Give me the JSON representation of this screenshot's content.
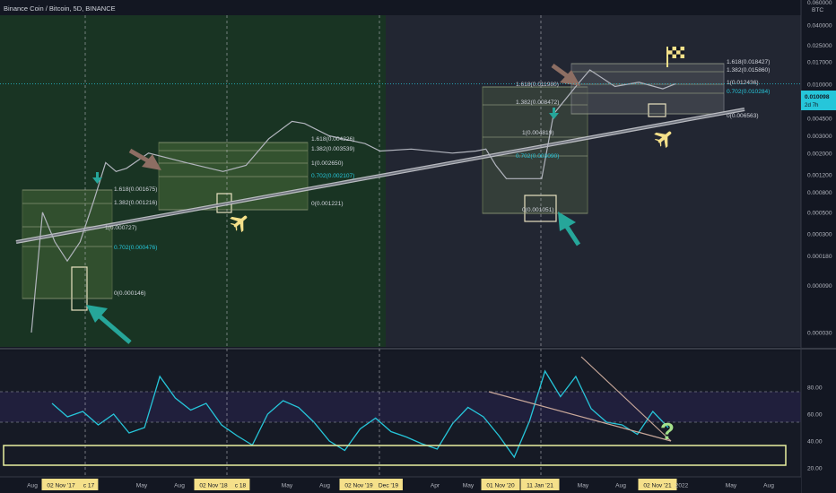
{
  "header": {
    "title": "Binance Coin / Bitcoin, 5D, BINANCE"
  },
  "price_axis": {
    "unit": "BTC",
    "top_tick": "0.060000",
    "ticks": [
      "0.040000",
      "0.025000",
      "0.017000",
      "0.010000",
      "0.007000",
      "0.004500",
      "0.003000",
      "0.002000",
      "0.001200",
      "0.000800",
      "0.000500",
      "0.000300",
      "0.000180",
      "0.000090",
      "0.000030"
    ],
    "current_price": "0.010098",
    "current_label_2": "2d 7h",
    "scale": "log"
  },
  "rsi_axis": {
    "ticks": [
      "80.00",
      "60.00",
      "40.00",
      "20.00"
    ],
    "upper_band": 70,
    "lower_band": 30
  },
  "time_axis": {
    "labels": [
      "Aug",
      "02 Nov '17",
      "c 17",
      "May",
      "Aug",
      "02 Nov '18",
      "c 18",
      "May",
      "Aug",
      "02 Nov '19",
      "Dec '19",
      "Apr",
      "May",
      "01 Nov '20",
      "11 Jan '21",
      "May",
      "Aug",
      "02 Nov '21",
      "2022",
      "May",
      "Aug"
    ],
    "highlighted": [
      "02 Nov '17",
      "c 17",
      "02 Nov '18",
      "c 18",
      "02 Nov '19",
      "Dec '19",
      "01 Nov '20",
      "11 Jan '21",
      "02 Nov '21"
    ]
  },
  "fib_1": {
    "levels": [
      "1.618(0.001675)",
      "1.382(0.001216)",
      "1(0.000727)",
      "0.702(0.000476)",
      "0(0.000146)"
    ]
  },
  "fib_2": {
    "levels": [
      "1.618(0.004226)",
      "1.382(0.003539)",
      "1(0.002650)",
      "0.702(0.002107)",
      "0(0.001221)"
    ]
  },
  "fib_3": {
    "levels": [
      "1.618(0.011980)",
      "1.382(0.008472)",
      "1(0.004819)",
      "0.702(0.003090)",
      "0(0.001051)"
    ]
  },
  "fib_4": {
    "levels": [
      "1.618(0.018427)",
      "1.382(0.015860)",
      "1(0.012436)",
      "0.702(0.010284)",
      "0(0.006563)"
    ]
  },
  "annotations": {
    "question_mark": "?"
  },
  "colors": {
    "background": "#131722",
    "price_line": "#b2b5be",
    "rsi_line": "#26c6da",
    "fib_text": "#d1d4dc",
    "fib_accent": "#26c6da",
    "green_zone": "#1b3a23",
    "arrow_teal": "#26a69a",
    "arrow_brown": "#8d6e63",
    "airplane": "#f5e08a",
    "label_bg": "#f5e08a"
  },
  "chart_data": {
    "type": "line",
    "title": "Binance Coin / Bitcoin, 5D, BINANCE",
    "y_scale": "log",
    "ylim": [
      3e-05,
      0.06
    ],
    "series": [
      {
        "name": "Binance Coin / Bitcoin",
        "x": [
          "2017-07",
          "2017-08",
          "2017-09",
          "2017-10",
          "2017-11",
          "2017-12",
          "2018-01",
          "2018-02",
          "2018-03",
          "2018-05",
          "2018-08",
          "2018-11",
          "2019-01",
          "2019-03",
          "2019-05",
          "2019-06",
          "2019-08",
          "2019-11",
          "2019-12",
          "2020-02",
          "2020-04",
          "2020-06",
          "2020-08",
          "2020-10",
          "2020-11",
          "2021-01",
          "2021-02",
          "2021-04",
          "2021-05",
          "2021-07",
          "2021-09",
          "2021-11",
          "2021-12"
        ],
        "values": [
          3e-05,
          0.0005,
          0.00025,
          0.00016,
          0.00025,
          0.00065,
          0.0016,
          0.0013,
          0.0014,
          0.002,
          0.0016,
          0.0013,
          0.0015,
          0.0028,
          0.0042,
          0.004,
          0.003,
          0.0025,
          0.0021,
          0.0022,
          0.002,
          0.0021,
          0.0022,
          0.0015,
          0.0011,
          0.0011,
          0.005,
          0.01,
          0.014,
          0.0095,
          0.0105,
          0.009,
          0.0101
        ]
      }
    ],
    "rsi": {
      "name": "RSI",
      "ylim": [
        20,
        100
      ],
      "values": [
        68,
        58,
        62,
        52,
        60,
        46,
        50,
        88,
        72,
        63,
        68,
        52,
        44,
        37,
        60,
        70,
        65,
        54,
        40,
        33,
        49,
        57,
        47,
        43,
        38,
        34,
        53,
        65,
        58,
        44,
        28,
        55,
        92,
        73,
        88,
        64,
        54,
        52,
        45,
        62,
        50
      ]
    }
  }
}
